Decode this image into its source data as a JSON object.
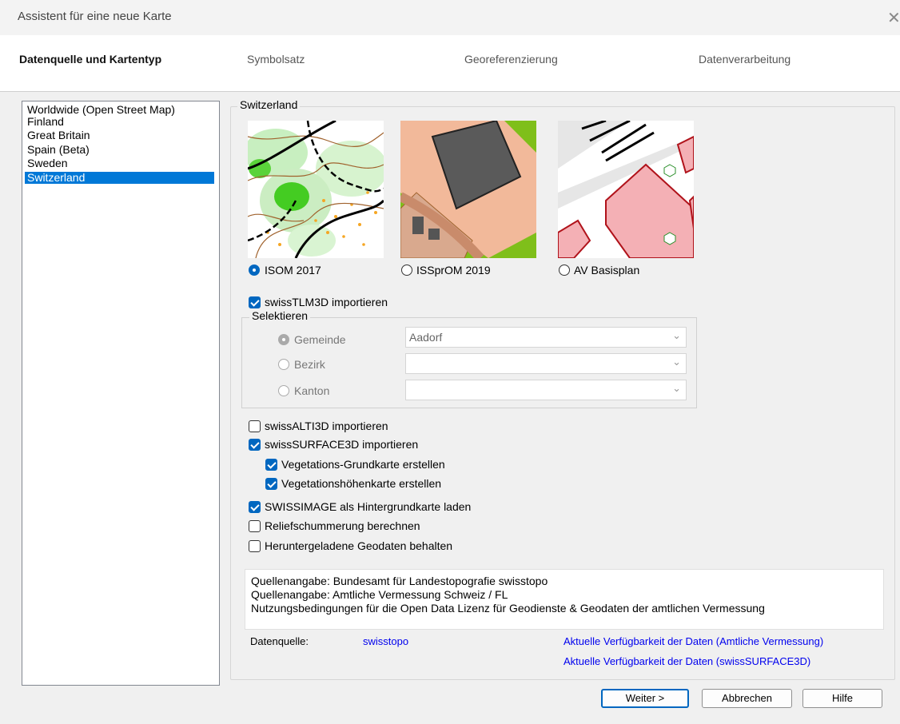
{
  "window": {
    "title": "Assistent für eine neue Karte",
    "close_glyph": "✕"
  },
  "steps": [
    "Datenquelle und Kartentyp",
    "Symbolsatz",
    "Georeferenzierung",
    "Datenverarbeitung"
  ],
  "countries": [
    "Worldwide (Open Street Map)",
    "Finland",
    "Great Britain",
    "Spain (Beta)",
    "Sweden",
    "Switzerland"
  ],
  "selected_country": "Switzerland",
  "group_title": "Switzerland",
  "map_types": [
    {
      "label": "ISOM 2017",
      "selected": true
    },
    {
      "label": "ISSprOM 2019",
      "selected": false
    },
    {
      "label": "AV Basisplan",
      "selected": false
    }
  ],
  "tlm": {
    "label": "swissTLM3D importieren",
    "checked": true
  },
  "select_group": {
    "title": "Selektieren",
    "options": [
      {
        "label": "Gemeinde",
        "selected": true,
        "value": "Aadorf"
      },
      {
        "label": "Bezirk",
        "selected": false,
        "value": ""
      },
      {
        "label": "Kanton",
        "selected": false,
        "value": ""
      }
    ]
  },
  "checks": {
    "alti": {
      "label": "swissALTI3D importieren",
      "checked": false
    },
    "surface": {
      "label": "swissSURFACE3D importieren",
      "checked": true
    },
    "veg_grund": {
      "label": "Vegetations-Grundkarte erstellen",
      "checked": true
    },
    "veg_hoehe": {
      "label": "Vegetationshöhenkarte erstellen",
      "checked": true
    },
    "swissimage": {
      "label": "SWISSIMAGE als Hintergrundkarte laden",
      "checked": true
    },
    "relief": {
      "label": "Reliefschummerung berechnen",
      "checked": false
    },
    "geodaten": {
      "label": "Heruntergeladene Geodaten behalten",
      "checked": false
    }
  },
  "info_lines": [
    "Quellenangabe: Bundesamt für Landestopografie swisstopo",
    "Quellenangabe: Amtliche Vermessung Schweiz / FL",
    "Nutzungsbedingungen für die Open Data Lizenz für Geodienste & Geodaten der amtlichen Vermessung"
  ],
  "datasource": {
    "label": "Datenquelle:",
    "value": "swisstopo",
    "link_av": "Aktuelle Verfügbarkeit der Daten (Amtliche Vermessung)",
    "link_surface": "Aktuelle Verfügbarkeit der Daten (swissSURFACE3D)"
  },
  "buttons": {
    "next": "Weiter >",
    "cancel": "Abbrechen",
    "help": "Hilfe"
  }
}
